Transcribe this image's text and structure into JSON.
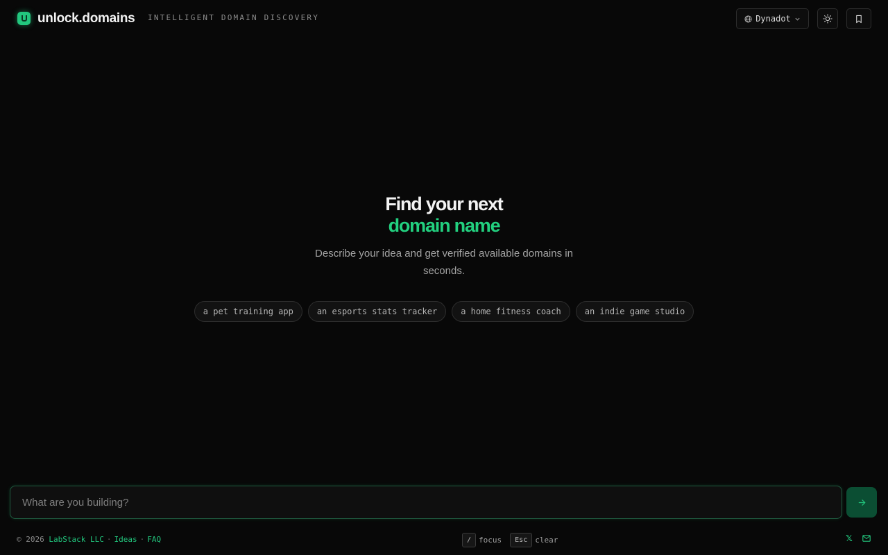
{
  "header": {
    "brand": "unlock.domains",
    "tagline": "INTELLIGENT DOMAIN DISCOVERY",
    "registrar_label": "Dynadot"
  },
  "hero": {
    "title_line1": "Find your next",
    "title_line2": "domain name",
    "subtitle": "Describe your idea and get verified available domains in seconds."
  },
  "suggestions": [
    "a pet training app",
    "an esports stats tracker",
    "a home fitness coach",
    "an indie game studio"
  ],
  "search": {
    "placeholder": "What are you building?",
    "value": ""
  },
  "footer": {
    "copyright": "© 2026",
    "company": "LabStack LLC",
    "links": [
      "Ideas",
      "FAQ"
    ],
    "separator": "·",
    "shortcuts": [
      {
        "key": "/",
        "label": "focus"
      },
      {
        "key": "Esc",
        "label": "clear"
      }
    ],
    "social_x": "𝕏"
  },
  "colors": {
    "accent": "#22c77e",
    "background": "#080808",
    "submit_bg": "#0b4e33"
  },
  "icons": {
    "logo": "unlock-logo-icon",
    "registrar": "globe-icon",
    "dropdown": "chevron-down-icon",
    "theme": "sun-icon",
    "saved": "bookmark-icon",
    "submit": "arrow-right-icon",
    "mail": "mail-icon"
  }
}
